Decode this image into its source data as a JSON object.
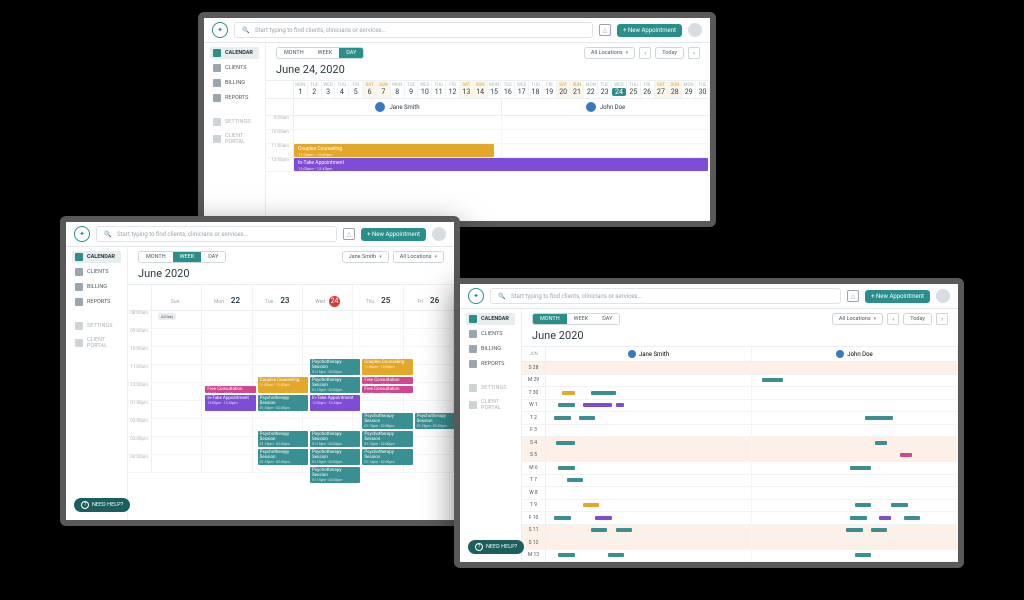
{
  "search_placeholder": "Start typing to find clients, clinicians or services...",
  "btn_new_appointment": "+ New Appointment",
  "sidebar": {
    "items": [
      {
        "icon": "calendar",
        "label": "CALENDAR"
      },
      {
        "icon": "clients",
        "label": "CLIENTS"
      },
      {
        "icon": "billing",
        "label": "BILLING"
      },
      {
        "icon": "reports",
        "label": "REPORTS"
      }
    ],
    "secondary": [
      {
        "icon": "settings",
        "label": "SETTINGS"
      },
      {
        "icon": "portal",
        "label": "CLIENT PORTAL"
      }
    ]
  },
  "toggles": {
    "month": "MONTH",
    "week": "WEEK",
    "day": "DAY"
  },
  "filter_all_locations": "All Locations",
  "filter_staff": "Jane Smith",
  "btn_today": "Today",
  "help": "NEED HELP?",
  "staff_names": [
    "Jane Smith",
    "John Doe"
  ],
  "day_view": {
    "title": "June 24, 2020",
    "days": [
      {
        "dow": "MON",
        "n": "1"
      },
      {
        "dow": "TUE",
        "n": "2"
      },
      {
        "dow": "WED",
        "n": "3"
      },
      {
        "dow": "THU",
        "n": "4"
      },
      {
        "dow": "FRI",
        "n": "5"
      },
      {
        "dow": "SAT",
        "n": "6",
        "weekend": true
      },
      {
        "dow": "SUN",
        "n": "7",
        "weekend": true
      },
      {
        "dow": "MON",
        "n": "8"
      },
      {
        "dow": "TUE",
        "n": "9"
      },
      {
        "dow": "WED",
        "n": "10"
      },
      {
        "dow": "THU",
        "n": "11"
      },
      {
        "dow": "FRI",
        "n": "12"
      },
      {
        "dow": "SAT",
        "n": "13",
        "weekend": true
      },
      {
        "dow": "SUN",
        "n": "14",
        "weekend": true
      },
      {
        "dow": "MON",
        "n": "15"
      },
      {
        "dow": "TUE",
        "n": "16"
      },
      {
        "dow": "WED",
        "n": "17"
      },
      {
        "dow": "THU",
        "n": "18"
      },
      {
        "dow": "FRI",
        "n": "19"
      },
      {
        "dow": "SAT",
        "n": "20",
        "weekend": true
      },
      {
        "dow": "SUN",
        "n": "21",
        "weekend": true
      },
      {
        "dow": "MON",
        "n": "22"
      },
      {
        "dow": "TUE",
        "n": "23"
      },
      {
        "dow": "WED",
        "n": "24",
        "today": true
      },
      {
        "dow": "THU",
        "n": "25"
      },
      {
        "dow": "FRI",
        "n": "26"
      },
      {
        "dow": "SAT",
        "n": "27",
        "weekend": true
      },
      {
        "dow": "SUN",
        "n": "28",
        "weekend": true
      },
      {
        "dow": "MON",
        "n": "29"
      },
      {
        "dow": "TUE",
        "n": "30"
      }
    ],
    "hours": [
      "9:00am",
      "10:00am",
      "11:00am",
      "12:00pm"
    ],
    "events": [
      {
        "title": "Couples Counseling",
        "time": "11:00am - 12:00pm",
        "cls": "ev-gold"
      },
      {
        "title": "In-Take Appointment",
        "time": "12:00pm - 12:45pm",
        "cls": "ev-purple"
      }
    ]
  },
  "week_view": {
    "title": "June 2020",
    "days": [
      {
        "dow": "Sun",
        "n": ""
      },
      {
        "dow": "Mon",
        "n": "22"
      },
      {
        "dow": "Tue",
        "n": "23"
      },
      {
        "dow": "Wed",
        "n": "24",
        "today": true
      },
      {
        "dow": "Thu",
        "n": "25"
      },
      {
        "dow": "Fri",
        "n": "26"
      }
    ],
    "hours": [
      "08:00am",
      "09:00am",
      "10:00am",
      "11:00am",
      "12:00pm",
      "01:00pm",
      "02:00pm",
      "03:00pm",
      "04:00pm"
    ],
    "tag_allday": "All Day",
    "event_types": {
      "psych": {
        "title": "Psychotherapy Session",
        "time": "01:15pm - 02:00pm"
      },
      "intake": {
        "title": "In-Take Appointment",
        "time": "12:00pm - 12:45pm"
      },
      "couples": {
        "title": "Couples Counseling",
        "time": "11:00am - 12:00pm"
      },
      "free": {
        "title": "Free Consultation",
        "time": "10:30am - 10:45am"
      }
    }
  },
  "month_view": {
    "title": "June 2020",
    "week_label": "JUN",
    "days": [
      "S 28",
      "M 29",
      "T 30",
      "W 1",
      "T 2",
      "F 3",
      "S 4",
      "S 5",
      "M 6",
      "T 7",
      "W 8",
      "T 9",
      "F 10",
      "S 11",
      "S 12",
      "M 13"
    ]
  }
}
